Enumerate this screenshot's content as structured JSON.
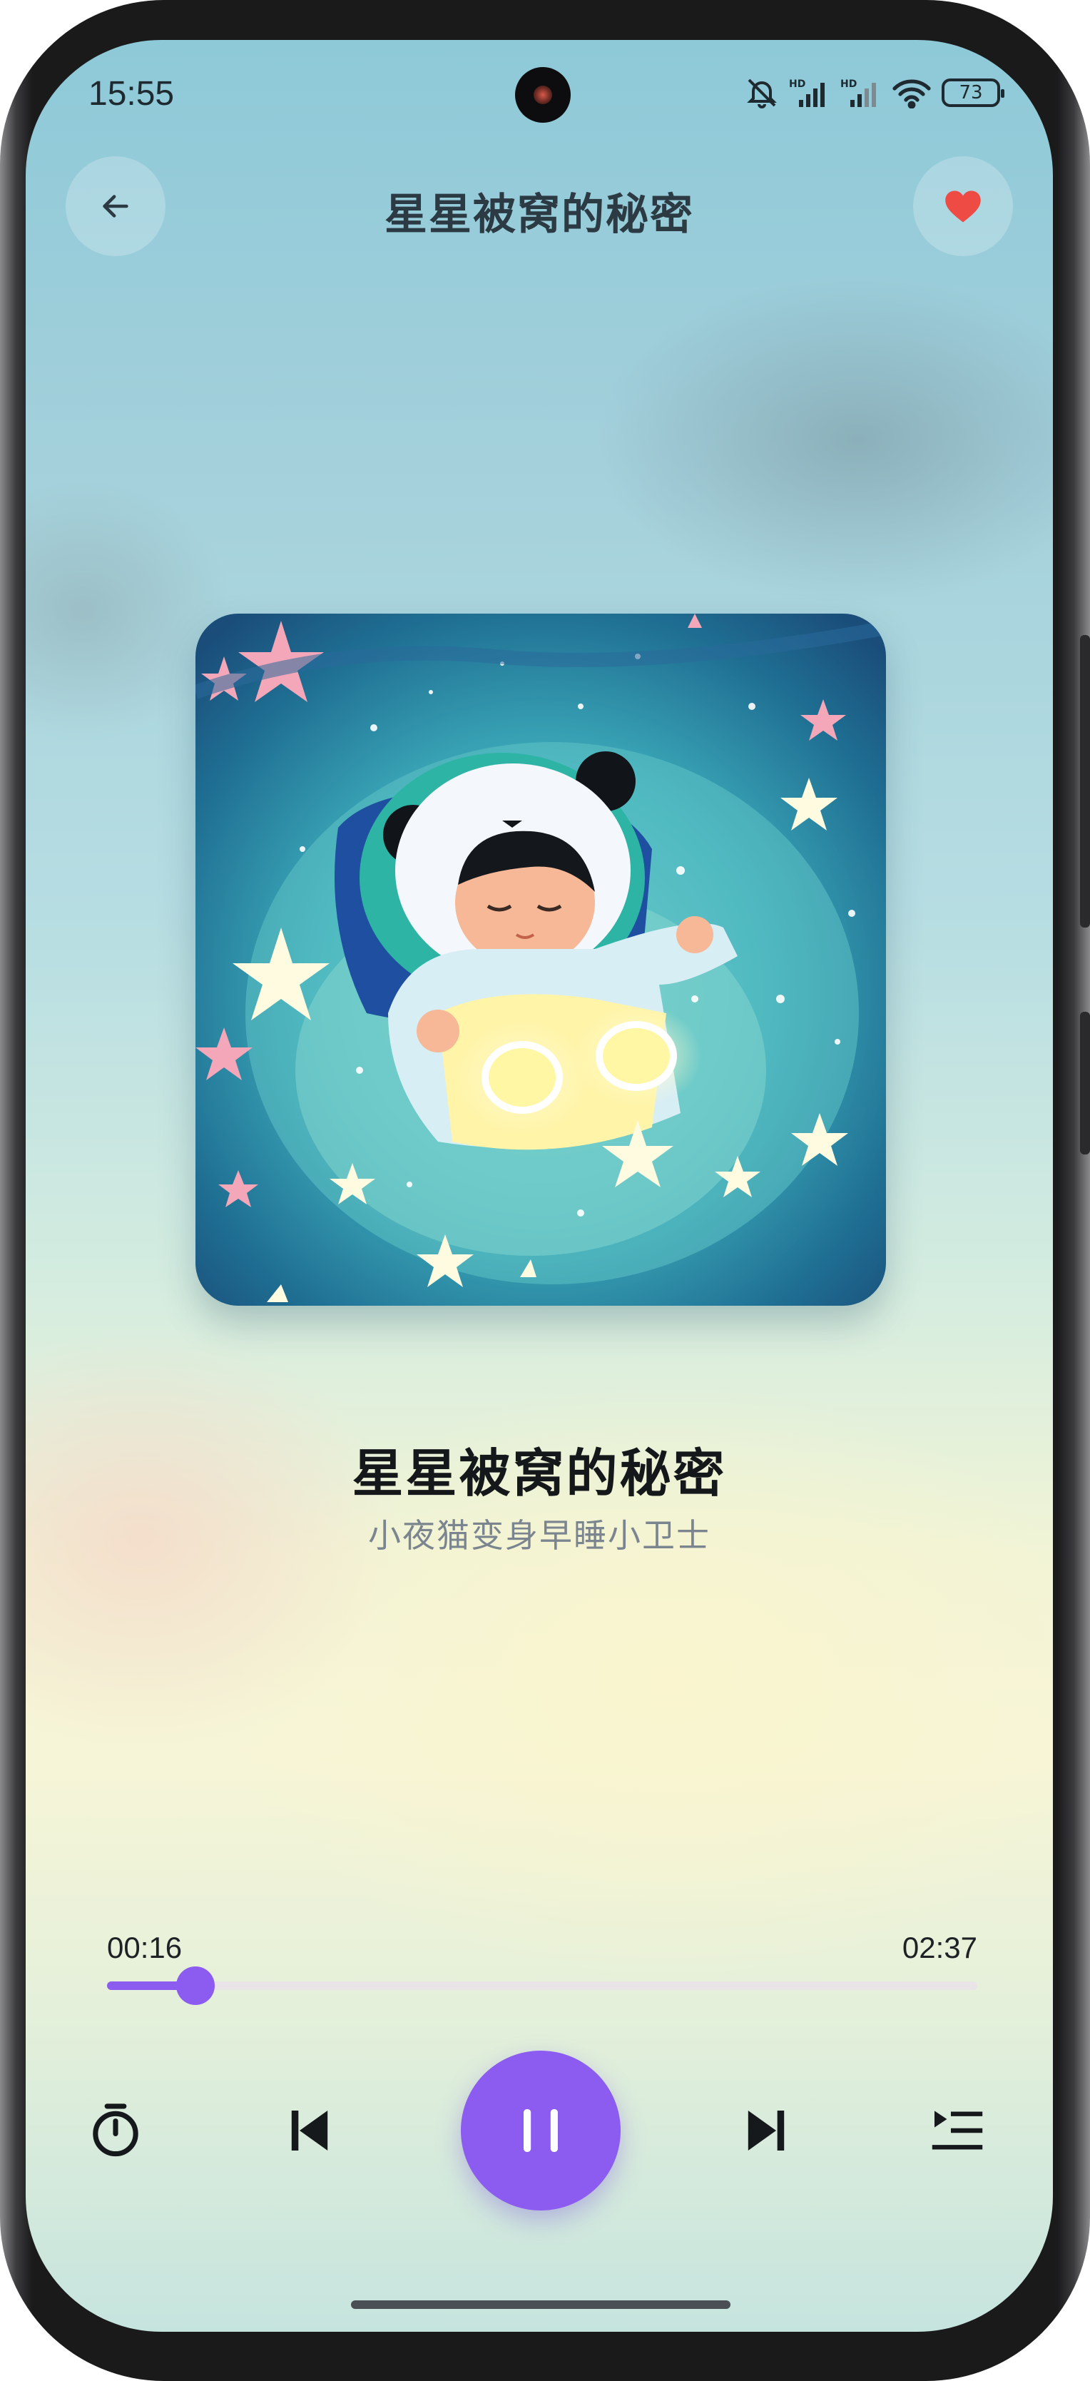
{
  "status_bar": {
    "time": "15:55",
    "battery": "73"
  },
  "header": {
    "title": "星星被窝的秘密"
  },
  "track": {
    "title": "星星被窝的秘密",
    "subtitle": "小夜猫变身早睡小卫士"
  },
  "player": {
    "elapsed": "00:16",
    "duration": "02:37",
    "progress_fraction": 0.102,
    "state": "playing"
  },
  "icons": {
    "back": "arrow-left-icon",
    "favorite": "heart-icon",
    "timer": "timer-icon",
    "previous": "skip-previous-icon",
    "pause": "pause-icon",
    "next": "skip-next-icon",
    "playlist": "playlist-icon"
  },
  "colors": {
    "accent": "#8c5cf0",
    "favorite": "#ee4b45"
  }
}
